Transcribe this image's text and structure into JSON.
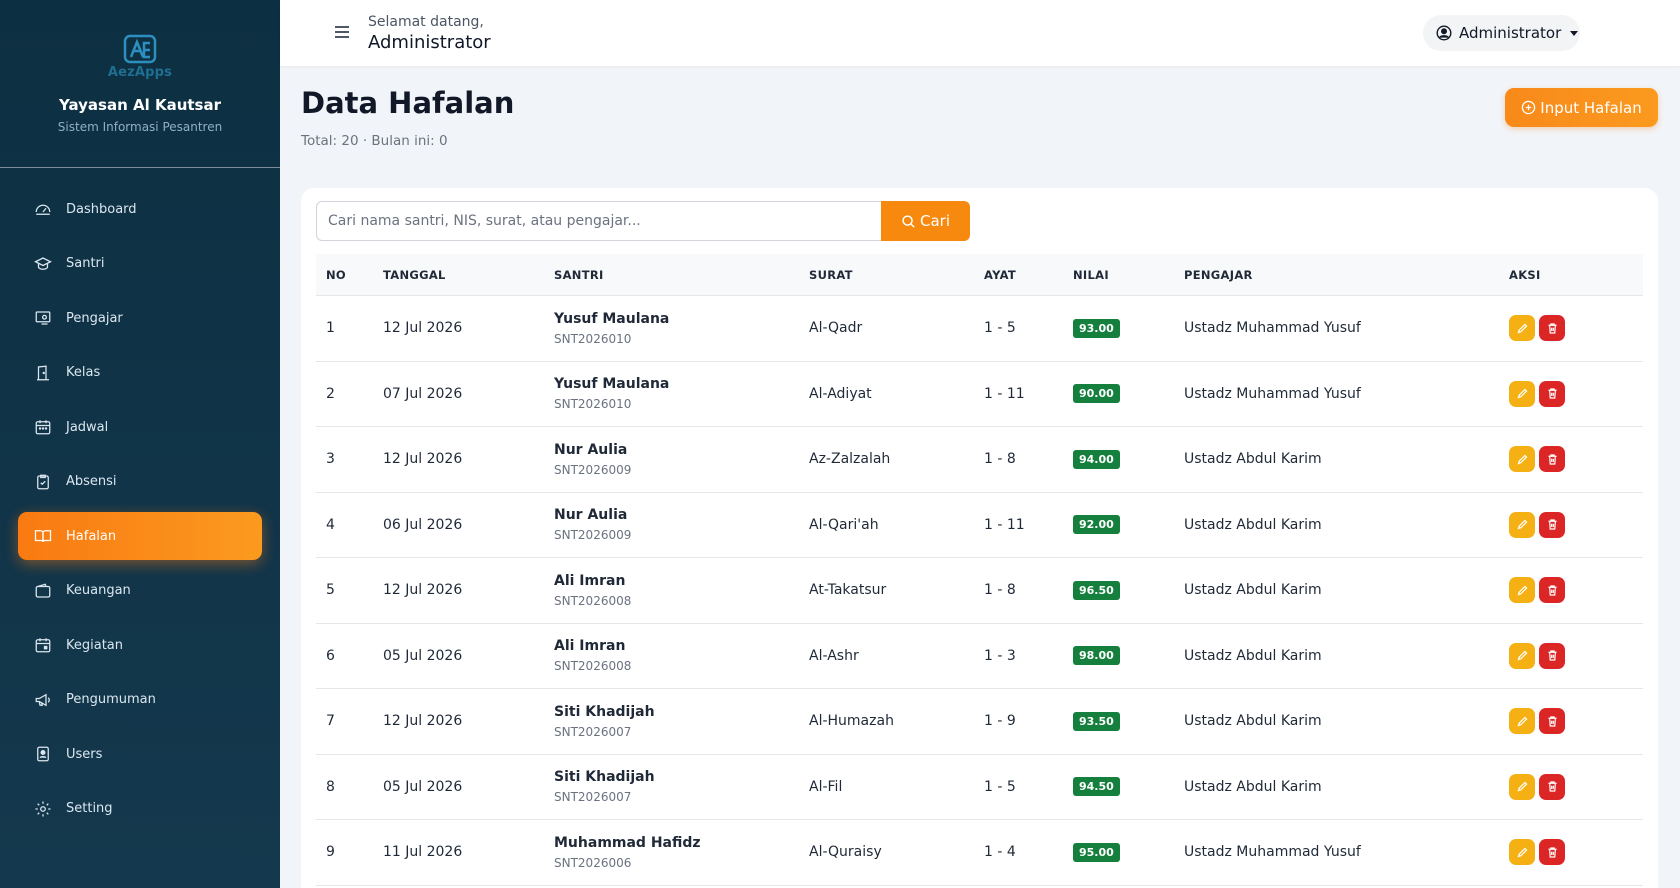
{
  "brand": {
    "logo_text": "AezApps",
    "org_name": "Yayasan Al Kautsar",
    "org_sub": "Sistem Informasi Pesantren"
  },
  "nav": [
    {
      "label": "Dashboard",
      "icon": "dashboard-icon"
    },
    {
      "label": "Santri",
      "icon": "graduation-cap-icon"
    },
    {
      "label": "Pengajar",
      "icon": "teacher-icon"
    },
    {
      "label": "Kelas",
      "icon": "door-icon"
    },
    {
      "label": "Jadwal",
      "icon": "calendar-icon"
    },
    {
      "label": "Absensi",
      "icon": "clipboard-check-icon"
    },
    {
      "label": "Hafalan",
      "icon": "book-icon",
      "active": true
    },
    {
      "label": "Keuangan",
      "icon": "wallet-icon"
    },
    {
      "label": "Kegiatan",
      "icon": "calendar-event-icon"
    },
    {
      "label": "Pengumuman",
      "icon": "megaphone-icon"
    },
    {
      "label": "Users",
      "icon": "user-badge-icon"
    },
    {
      "label": "Setting",
      "icon": "gear-icon"
    }
  ],
  "topbar": {
    "welcome": "Selamat datang,",
    "user": "Administrator",
    "menu_label": "Administrator"
  },
  "page": {
    "title": "Data Hafalan",
    "subtitle": "Total: 20 · Bulan ini: 0",
    "input_button": "Input Hafalan"
  },
  "search": {
    "placeholder": "Cari nama santri, NIS, surat, atau pengajar...",
    "button": "Cari"
  },
  "table": {
    "headers": {
      "no": "NO",
      "tanggal": "TANGGAL",
      "santri": "SANTRI",
      "surat": "SURAT",
      "ayat": "AYAT",
      "nilai": "NILAI",
      "pengajar": "PENGAJAR",
      "aksi": "AKSI"
    },
    "rows": [
      {
        "no": "1",
        "tanggal": "12 Jul 2026",
        "santri": "Yusuf Maulana",
        "nis": "SNT2026010",
        "surat": "Al-Qadr",
        "ayat": "1 - 5",
        "nilai": "93.00",
        "pengajar": "Ustadz Muhammad Yusuf"
      },
      {
        "no": "2",
        "tanggal": "07 Jul 2026",
        "santri": "Yusuf Maulana",
        "nis": "SNT2026010",
        "surat": "Al-Adiyat",
        "ayat": "1 - 11",
        "nilai": "90.00",
        "pengajar": "Ustadz Muhammad Yusuf"
      },
      {
        "no": "3",
        "tanggal": "12 Jul 2026",
        "santri": "Nur Aulia",
        "nis": "SNT2026009",
        "surat": "Az-Zalzalah",
        "ayat": "1 - 8",
        "nilai": "94.00",
        "pengajar": "Ustadz Abdul Karim"
      },
      {
        "no": "4",
        "tanggal": "06 Jul 2026",
        "santri": "Nur Aulia",
        "nis": "SNT2026009",
        "surat": "Al-Qari'ah",
        "ayat": "1 - 11",
        "nilai": "92.00",
        "pengajar": "Ustadz Abdul Karim"
      },
      {
        "no": "5",
        "tanggal": "12 Jul 2026",
        "santri": "Ali Imran",
        "nis": "SNT2026008",
        "surat": "At-Takatsur",
        "ayat": "1 - 8",
        "nilai": "96.50",
        "pengajar": "Ustadz Abdul Karim"
      },
      {
        "no": "6",
        "tanggal": "05 Jul 2026",
        "santri": "Ali Imran",
        "nis": "SNT2026008",
        "surat": "Al-Ashr",
        "ayat": "1 - 3",
        "nilai": "98.00",
        "pengajar": "Ustadz Abdul Karim"
      },
      {
        "no": "7",
        "tanggal": "12 Jul 2026",
        "santri": "Siti Khadijah",
        "nis": "SNT2026007",
        "surat": "Al-Humazah",
        "ayat": "1 - 9",
        "nilai": "93.50",
        "pengajar": "Ustadz Abdul Karim"
      },
      {
        "no": "8",
        "tanggal": "05 Jul 2026",
        "santri": "Siti Khadijah",
        "nis": "SNT2026007",
        "surat": "Al-Fil",
        "ayat": "1 - 5",
        "nilai": "94.50",
        "pengajar": "Ustadz Abdul Karim"
      },
      {
        "no": "9",
        "tanggal": "11 Jul 2026",
        "santri": "Muhammad Hafidz",
        "nis": "SNT2026006",
        "surat": "Al-Quraisy",
        "ayat": "1 - 4",
        "nilai": "95.00",
        "pengajar": "Ustadz Muhammad Yusuf"
      }
    ]
  },
  "colors": {
    "sidebar": "#0d2f42",
    "accent": "#f97a12",
    "badge": "#15803d",
    "edit": "#f5b014",
    "delete": "#dc2626"
  }
}
